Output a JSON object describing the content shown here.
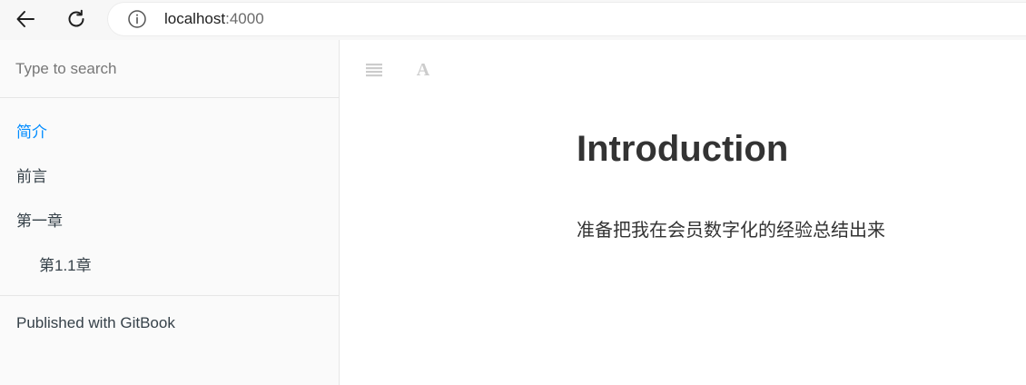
{
  "browser": {
    "url_host": "localhost",
    "url_port": ":4000"
  },
  "sidebar": {
    "search_placeholder": "Type to search",
    "items": [
      {
        "label": "简介",
        "active": true,
        "level": 1
      },
      {
        "label": "前言",
        "active": false,
        "level": 1
      },
      {
        "label": "第一章",
        "active": false,
        "level": 1
      },
      {
        "label": "第1.1章",
        "active": false,
        "level": 2
      }
    ],
    "published_with": "Published with GitBook"
  },
  "toolbar": {
    "toc_icon": "list-icon",
    "font_icon": "font-settings-icon",
    "font_glyph": "A"
  },
  "content": {
    "title": "Introduction",
    "paragraph": "准备把我在会员数字化的经验总结出来"
  },
  "colors": {
    "accent": "#008cff",
    "text": "#333333",
    "icon_muted": "#cccccc"
  }
}
